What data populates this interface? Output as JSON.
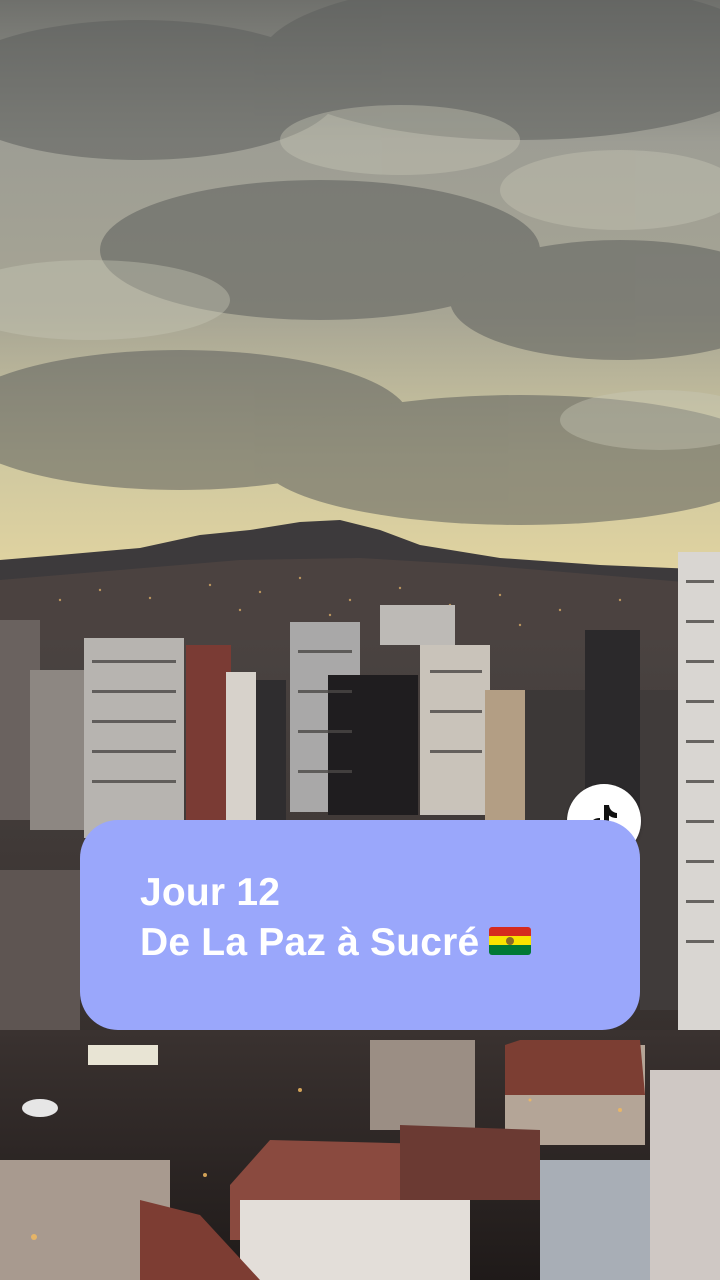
{
  "scene": {
    "description_icon": "city-skyline-photo"
  },
  "caption": {
    "line1": "Jour 12",
    "line2": "De La Paz à Sucré",
    "flag_icon": "bolivia-flag-icon",
    "background_color": "#9aa7fb",
    "text_color": "#ffffff"
  },
  "badge": {
    "icon": "tiktok-logo-icon"
  },
  "colors": {
    "flag_red": "#d52b1e",
    "flag_yellow": "#f9e300",
    "flag_green": "#007934"
  }
}
